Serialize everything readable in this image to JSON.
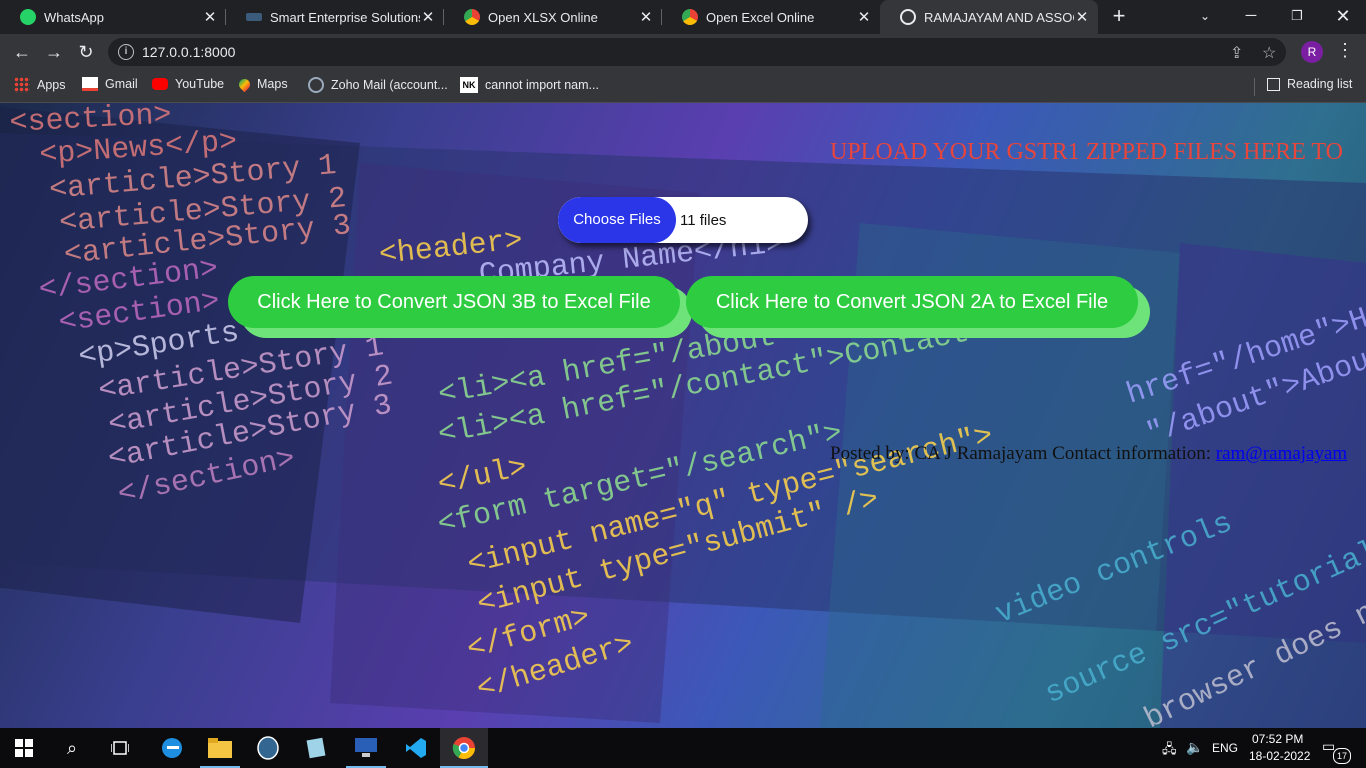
{
  "tabs": [
    {
      "label": "WhatsApp"
    },
    {
      "label": "Smart Enterprise Solutions - I"
    },
    {
      "label": "Open XLSX Online"
    },
    {
      "label": "Open Excel Online"
    },
    {
      "label": "RAMAJAYAM AND ASSOCIAT"
    }
  ],
  "tab_close": "✕",
  "address": {
    "url": "127.0.0.1:8000"
  },
  "profile_initial": "R",
  "bookmarks": [
    {
      "label": "Apps"
    },
    {
      "label": "Gmail"
    },
    {
      "label": "YouTube"
    },
    {
      "label": "Maps"
    },
    {
      "label": "Zoho Mail (account..."
    },
    {
      "label": "cannot import nam..."
    }
  ],
  "bookmark_nk_badge": "NK",
  "reading_list": "Reading list",
  "page": {
    "marquee": "UPLOAD YOUR GSTR1 ZIPPED FILES HERE TO",
    "choose_files": "Choose Files",
    "file_count": "11 files",
    "btn_3b": "Click Here to Convert JSON 3B to Excel File",
    "btn_2a": "Click Here to Convert JSON 2A to Excel File",
    "posted_by": "Posted by: CA J Ramajayam Contact information:",
    "contact_link": "ram@ramajayam"
  },
  "taskbar": {
    "lang": "ENG",
    "time": "07:52 PM",
    "date": "18-02-2022",
    "notif_count": "17"
  },
  "colors": {
    "marquee": "#e8453c",
    "choose": "#2b36e8",
    "convert": "#2ecc40"
  },
  "icons": [
    "whatsapp-icon",
    "chrome-icon",
    "globe-icon",
    "info-icon",
    "share-icon",
    "star-icon",
    "gmail-icon",
    "youtube-icon",
    "maps-icon",
    "zoho-icon",
    "windows-icon",
    "search-icon",
    "taskview-icon",
    "edge-icon",
    "folder-icon",
    "postgres-icon",
    "notepad-icon",
    "vscode-icon"
  ]
}
